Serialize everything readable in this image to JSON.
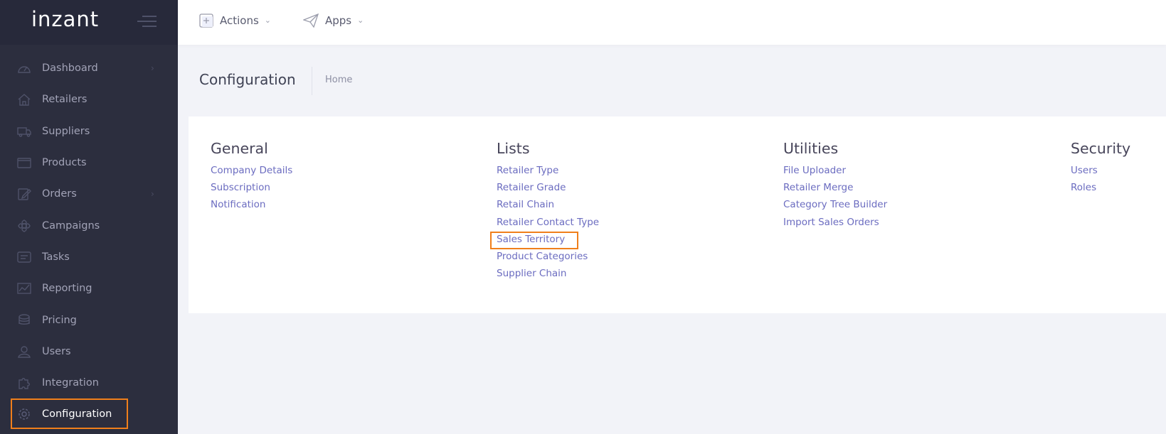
{
  "brand": {
    "logo_text": "inzant"
  },
  "sidebar": {
    "items": [
      {
        "label": "Dashboard",
        "icon": "dashboard-icon",
        "has_chevron": true
      },
      {
        "label": "Retailers",
        "icon": "home-icon",
        "has_chevron": false
      },
      {
        "label": "Suppliers",
        "icon": "truck-icon",
        "has_chevron": false
      },
      {
        "label": "Products",
        "icon": "box-icon",
        "has_chevron": false
      },
      {
        "label": "Orders",
        "icon": "edit-icon",
        "has_chevron": true
      },
      {
        "label": "Campaigns",
        "icon": "flower-icon",
        "has_chevron": false
      },
      {
        "label": "Tasks",
        "icon": "tasks-icon",
        "has_chevron": false
      },
      {
        "label": "Reporting",
        "icon": "chart-icon",
        "has_chevron": false
      },
      {
        "label": "Pricing",
        "icon": "layers-icon",
        "has_chevron": false
      },
      {
        "label": "Users",
        "icon": "user-icon",
        "has_chevron": false
      },
      {
        "label": "Integration",
        "icon": "puzzle-icon",
        "has_chevron": false
      },
      {
        "label": "Configuration",
        "icon": "gear-icon",
        "has_chevron": false,
        "active": true
      }
    ]
  },
  "topbar": {
    "actions_label": "Actions",
    "apps_label": "Apps"
  },
  "subheader": {
    "title": "Configuration",
    "breadcrumb": "Home"
  },
  "sections": {
    "general": {
      "title": "General",
      "links": [
        "Company Details",
        "Subscription",
        "Notification"
      ]
    },
    "lists": {
      "title": "Lists",
      "links": [
        "Retailer Type",
        "Retailer Grade",
        "Retail Chain",
        "Retailer Contact Type",
        "Sales Territory",
        "Product Categories",
        "Supplier Chain"
      ]
    },
    "utilities": {
      "title": "Utilities",
      "links": [
        "File Uploader",
        "Retailer Merge",
        "Category Tree Builder",
        "Import Sales Orders"
      ]
    },
    "security": {
      "title": "Security",
      "links": [
        "Users",
        "Roles"
      ]
    }
  },
  "colors": {
    "sidebar_bg": "#2c2e3e",
    "accent_highlight": "#f07f1b",
    "link": "#6b6cc0"
  }
}
